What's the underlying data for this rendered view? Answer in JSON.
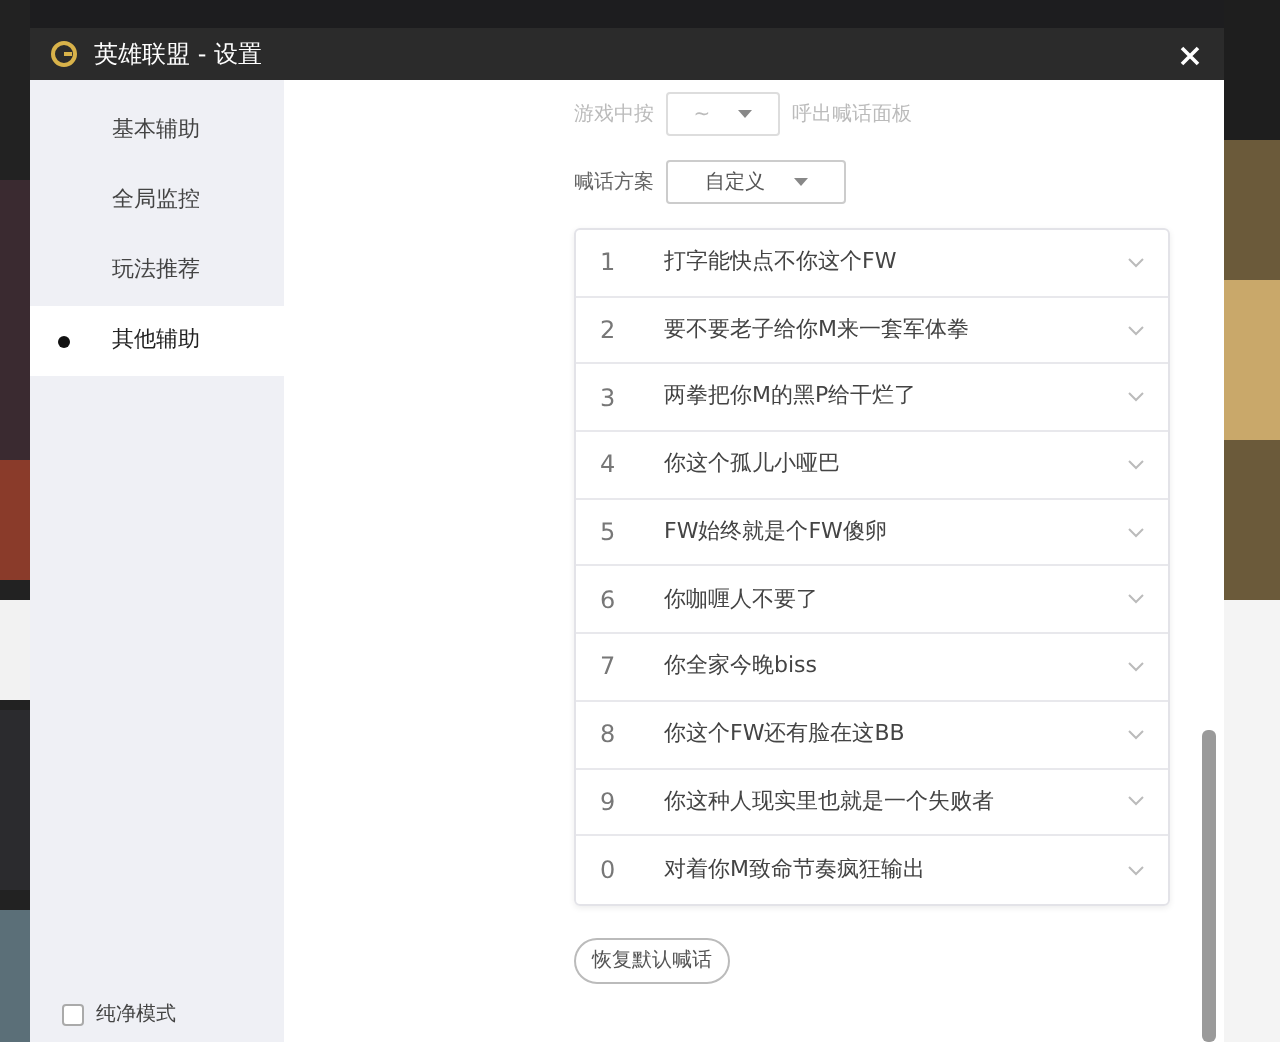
{
  "window": {
    "title": "英雄联盟 - 设置"
  },
  "sidebar": {
    "items": [
      {
        "label": "基本辅助",
        "selected": false
      },
      {
        "label": "全局监控",
        "selected": false
      },
      {
        "label": "玩法推荐",
        "selected": false
      },
      {
        "label": "其他辅助",
        "selected": true
      }
    ],
    "pure_mode": {
      "label": "纯净模式",
      "checked": false
    }
  },
  "hotkey": {
    "label": "游戏中按",
    "value": "~",
    "suffix": "呼出喊话面板",
    "disabled": true
  },
  "scheme": {
    "label": "喊话方案",
    "value": "自定义",
    "disabled": false
  },
  "phrases": [
    {
      "key": "1",
      "text": "打字能快点不你这个FW"
    },
    {
      "key": "2",
      "text": "要不要老子给你M来一套军体拳"
    },
    {
      "key": "3",
      "text": "两拳把你M的黑P给干烂了"
    },
    {
      "key": "4",
      "text": "你这个孤儿小哑巴"
    },
    {
      "key": "5",
      "text": "FW始终就是个FW傻卵"
    },
    {
      "key": "6",
      "text": "你咖喱人不要了"
    },
    {
      "key": "7",
      "text": "你全家今晚biss"
    },
    {
      "key": "8",
      "text": "你这个FW还有脸在这BB"
    },
    {
      "key": "9",
      "text": "你这种人现实里也就是一个失败者"
    },
    {
      "key": "0",
      "text": "对着你M致命节奏疯狂输出"
    }
  ],
  "reset_button": "恢复默认喊话"
}
